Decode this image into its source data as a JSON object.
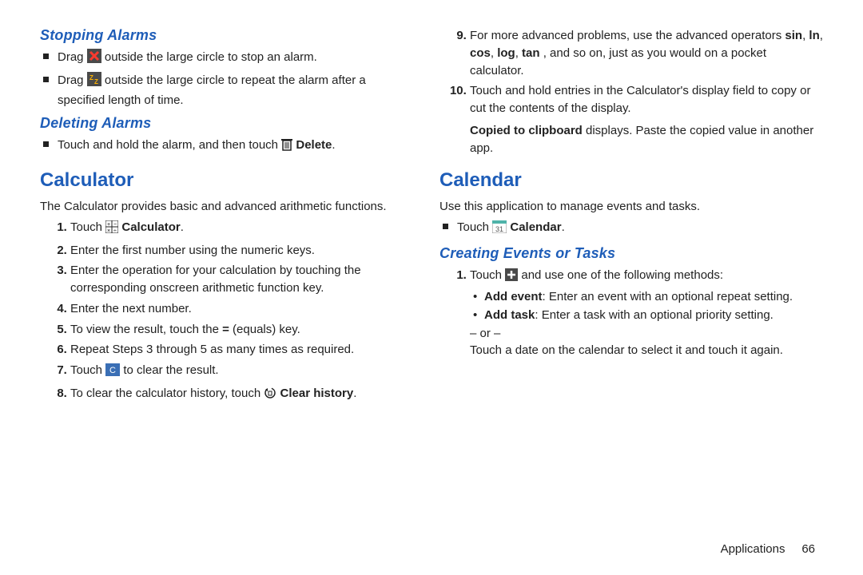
{
  "left": {
    "h_stopping": "Stopping Alarms",
    "stop_b1_a": "Drag ",
    "stop_b1_b": " outside the large circle to stop an alarm.",
    "stop_b2_a": "Drag ",
    "stop_b2_b": " outside the large circle to repeat the alarm after a specified length of time.",
    "h_deleting": "Deleting Alarms",
    "del_b1_a": "Touch and hold the alarm, and then touch ",
    "del_b1_bold": " Delete",
    "h_calc": "Calculator",
    "calc_intro": "The Calculator provides basic and advanced arithmetic functions.",
    "s1_a": "Touch ",
    "s1_bold": " Calculator",
    "s2": "Enter the first number using the numeric keys.",
    "s3": "Enter the operation for your calculation by touching the corresponding onscreen arithmetic function key.",
    "s4": "Enter the next number.",
    "s5_a": "To view the result, touch the ",
    "s5_b": " (equals) key.",
    "s6": "Repeat Steps 3 through 5 as many times as required.",
    "s7_a": "Touch ",
    "s7_b": " to clear the result.",
    "s8_a": "To clear the calculator history, touch ",
    "s8_bold": " Clear history"
  },
  "right": {
    "s9_a": "For more advanced problems, use the advanced operators ",
    "sin": "sin",
    "ln": "ln",
    "cos": "cos",
    "log": "log",
    "tan": "tan",
    "s9_b": ", and so on, just as you would on a pocket calculator.",
    "s10": "Touch and hold entries in the Calculator's display field to copy or cut the contents of the display.",
    "copied_bold": "Copied to clipboard",
    "copied_rest": " displays. Paste the copied value in another app.",
    "h_cal": "Calendar",
    "cal_intro": "Use this application to manage events and tasks.",
    "cal_b1_a": "Touch ",
    "cal_b1_bold": " Calendar",
    "h_creating": "Creating Events or Tasks",
    "c1_a": "Touch ",
    "c1_b": " and use one of the following methods:",
    "add_event_bold": "Add event",
    "add_event_rest": ": Enter an event with an optional repeat setting.",
    "add_task_bold": "Add task",
    "add_task_rest": ": Enter a task with an optional priority setting.",
    "or": "– or –",
    "touch_date": "Touch a date on the calendar to select it and touch it again."
  },
  "footer": {
    "section": "Applications",
    "page": "66"
  },
  "sep": ", ",
  "period": ".",
  "eq": "="
}
